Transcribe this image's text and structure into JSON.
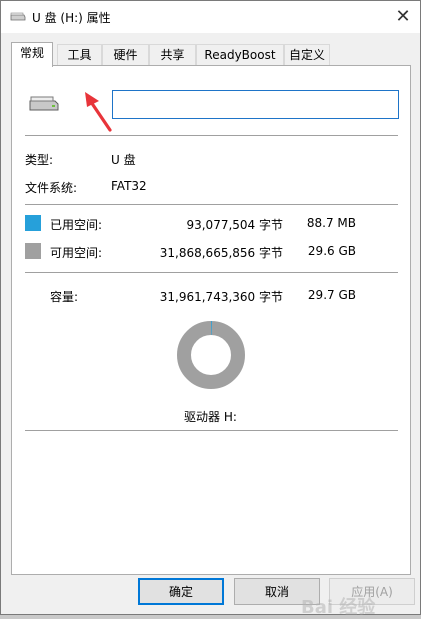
{
  "window": {
    "title": "U 盘 (H:) 属性",
    "close_glyph": "✕"
  },
  "tabs": [
    {
      "label": "常规",
      "active": true
    },
    {
      "label": "工具",
      "active": false
    },
    {
      "label": "硬件",
      "active": false
    },
    {
      "label": "共享",
      "active": false
    },
    {
      "label": "ReadyBoost",
      "active": false
    },
    {
      "label": "自定义",
      "active": false
    }
  ],
  "general": {
    "volume_label_value": "",
    "type_label": "类型:",
    "type_value": "U 盘",
    "fs_label": "文件系统:",
    "fs_value": "FAT32",
    "used": {
      "label": "已用空间:",
      "bytes": "93,077,504 字节",
      "size": "88.7 MB",
      "color": "#26a0da"
    },
    "free": {
      "label": "可用空间:",
      "bytes": "31,868,665,856 字节",
      "size": "29.6 GB",
      "color": "#a0a0a0"
    },
    "capacity": {
      "label": "容量:",
      "bytes": "31,961,743,360 字节",
      "size": "29.7 GB"
    },
    "usage_fraction": 0.0029,
    "drive_label": "驱动器 H:"
  },
  "buttons": {
    "ok": "确定",
    "cancel": "取消",
    "apply": "应用(A)"
  },
  "annotation": {
    "arrow_color": "#e8343a"
  },
  "watermark": {
    "text": "Bai 经验"
  }
}
